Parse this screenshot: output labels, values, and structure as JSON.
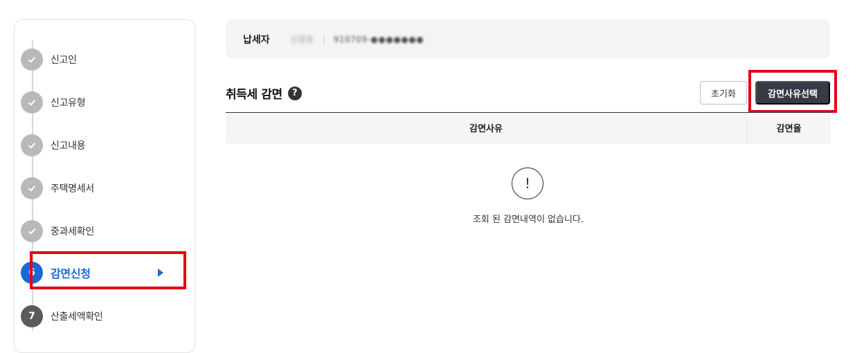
{
  "sidebar": {
    "steps": [
      {
        "num": "",
        "label": "신고인",
        "state": "done"
      },
      {
        "num": "",
        "label": "신고유형",
        "state": "done"
      },
      {
        "num": "",
        "label": "신고내용",
        "state": "done"
      },
      {
        "num": "",
        "label": "주택명세서",
        "state": "done"
      },
      {
        "num": "",
        "label": "중과세확인",
        "state": "done"
      },
      {
        "num": "6",
        "label": "감면신청",
        "state": "active"
      },
      {
        "num": "7",
        "label": "산출세액확인",
        "state": "pending"
      }
    ]
  },
  "taxpayer": {
    "label": "납세자",
    "name": "신정호",
    "id": "910709-●●●●●●●"
  },
  "section": {
    "title": "취득세 감면",
    "help_icon": "?"
  },
  "buttons": {
    "reset": "초기화",
    "select_reason": "감면사유선택"
  },
  "table": {
    "columns": [
      "감면사유",
      "감면율"
    ],
    "empty_icon": "!",
    "empty_message": "조회 된 감면내역이 없습니다."
  },
  "colors": {
    "active": "#1769d4",
    "done": "#b9b9b9",
    "pending": "#5a5a5a",
    "primary_button": "#383a45",
    "highlight": "#e60012"
  }
}
